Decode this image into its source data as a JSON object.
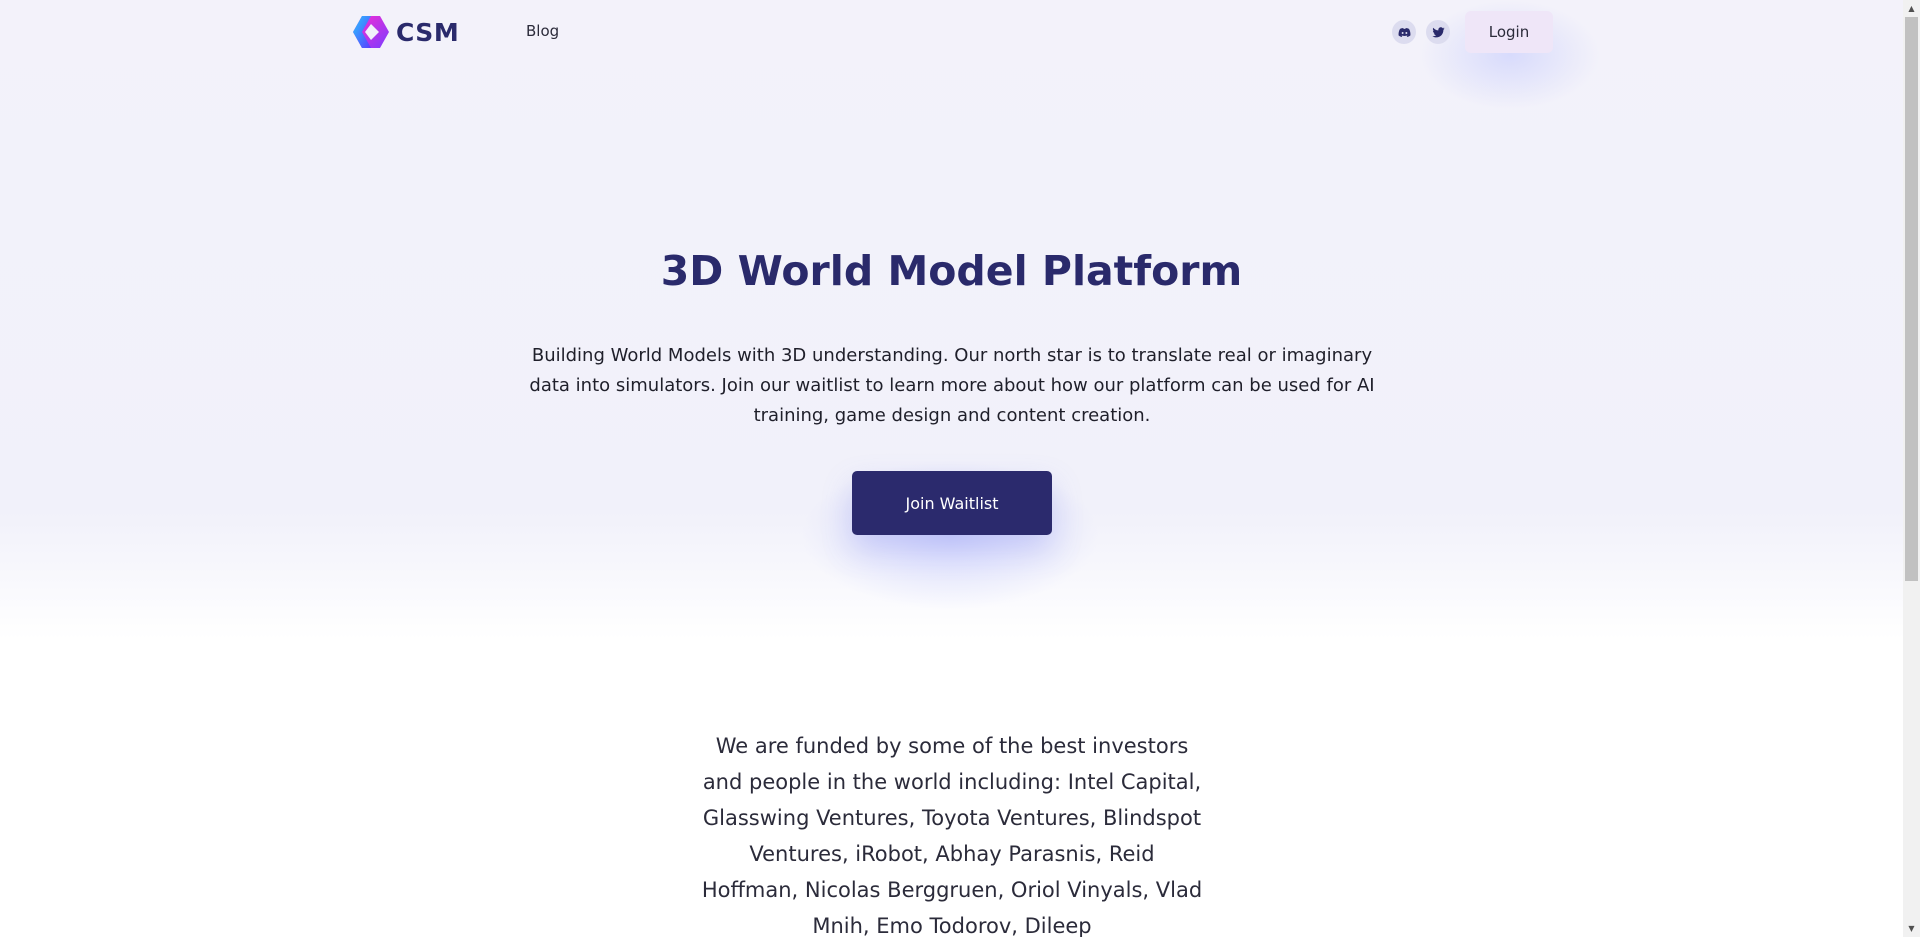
{
  "header": {
    "logo_text": "CSM",
    "nav_blog": "Blog",
    "social": {
      "discord_icon": "discord-icon",
      "twitter_icon": "twitter-icon"
    },
    "login_label": "Login"
  },
  "hero": {
    "title": "3D World Model Platform",
    "description": "Building World Models with 3D understanding. Our north star is to translate real or imaginary data into simulators. Join our waitlist to learn more about how our platform can be used for AI training, game design and content creation.",
    "cta_label": "Join Waitlist"
  },
  "investors": {
    "text": "We are funded by some of the best investors and people in the world including: Intel Capital, Glasswing Ventures, Toyota Ventures, Blindspot Ventures, iRobot, Abhay Parasnis, Reid Hoffman, Nicolas Berggruen, Oriol Vinyals, Vlad Mnih, Emo Todorov, Dileep"
  },
  "colors": {
    "brand_navy": "#2b2a6d",
    "hero_bg": "#f1f1fa",
    "login_bg": "#efe6f8",
    "logo_gradient": [
      "#ff2bd0",
      "#5a3cff",
      "#29c6ff"
    ]
  }
}
